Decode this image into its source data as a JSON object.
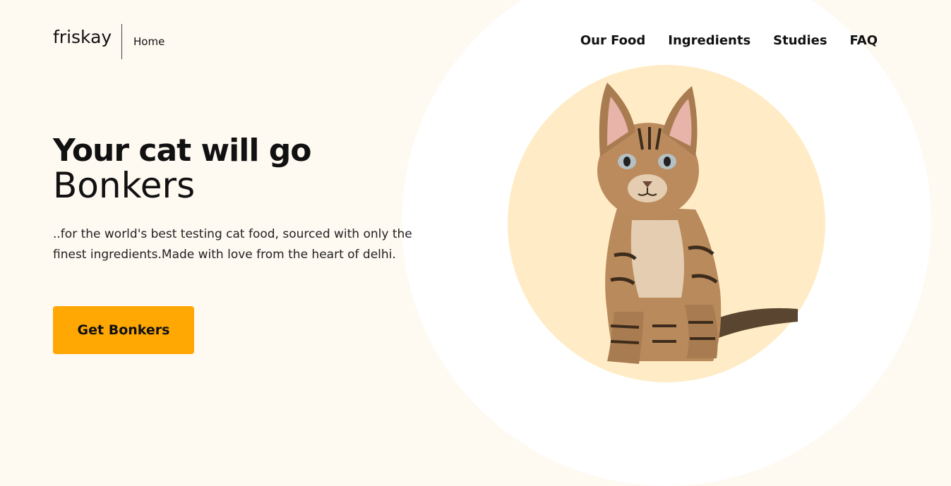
{
  "brand": {
    "name": "friskay"
  },
  "header": {
    "home_label": "Home",
    "nav": [
      {
        "label": "Our Food"
      },
      {
        "label": "Ingredients"
      },
      {
        "label": "Studies"
      },
      {
        "label": "FAQ"
      }
    ]
  },
  "hero": {
    "headline": "Your cat will go",
    "subheadline": "Bonkers",
    "tagline": "..for the world's best testing cat food, sourced with only the finest ingredients.Made with love from the heart of delhi.",
    "cta_label": "Get Bonkers",
    "image": "kitten-photo"
  },
  "colors": {
    "page_background": "#fef9f1",
    "circle_background": "#ffffff",
    "image_circle": "#ffecc6",
    "accent": "#ffa804",
    "text": "#111111"
  }
}
